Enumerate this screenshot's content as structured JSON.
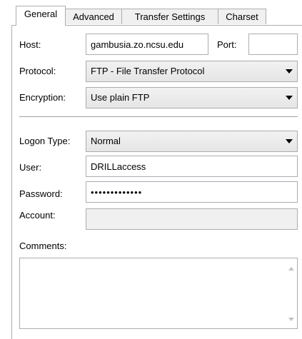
{
  "tabs": [
    {
      "label": "General",
      "active": true
    },
    {
      "label": "Advanced",
      "active": false
    },
    {
      "label": "Transfer Settings",
      "active": false
    },
    {
      "label": "Charset",
      "active": false
    }
  ],
  "host": {
    "label": "Host:",
    "value": "gambusia.zo.ncsu.edu"
  },
  "port": {
    "label": "Port:",
    "value": ""
  },
  "protocol": {
    "label": "Protocol:",
    "value": "FTP - File Transfer Protocol"
  },
  "encryption": {
    "label": "Encryption:",
    "value": "Use plain FTP"
  },
  "logon_type": {
    "label": "Logon Type:",
    "value": "Normal"
  },
  "user": {
    "label": "User:",
    "value": "DRILLaccess"
  },
  "password": {
    "label": "Password:",
    "value": "•••••••••••••"
  },
  "account": {
    "label": "Account:",
    "value": ""
  },
  "comments": {
    "label": "Comments:",
    "value": ""
  }
}
